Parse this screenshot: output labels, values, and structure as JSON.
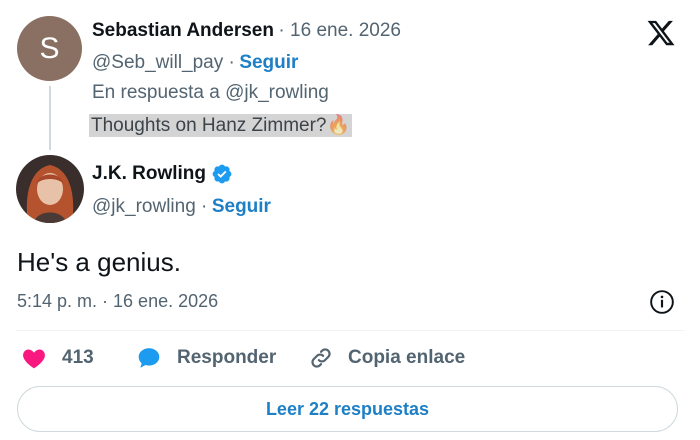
{
  "reply_tweet": {
    "avatar_letter": "S",
    "author_name": "Sebastian Andersen",
    "date": "· 16 ene. 2026",
    "handle": "@Seb_will_pay ·",
    "follow_label": "Seguir",
    "reply_context": "En respuesta a @jk_rowling",
    "text": "Thoughts on Hanz Zimmer?",
    "emoji": "🔥"
  },
  "main_tweet": {
    "author_name": "J.K. Rowling",
    "handle": "@jk_rowling ·",
    "follow_label": "Seguir",
    "text": "He's a genius.",
    "timestamp": "5:14 p. m. · 16 ene. 2026"
  },
  "actions": {
    "like_count": "413",
    "reply_label": "Responder",
    "copy_label": "Copia enlace"
  },
  "read_replies_label": "Leer 22 respuestas",
  "colors": {
    "accent": "#1d7fc6",
    "like": "#f91880",
    "verified": "#1d9bf0"
  }
}
